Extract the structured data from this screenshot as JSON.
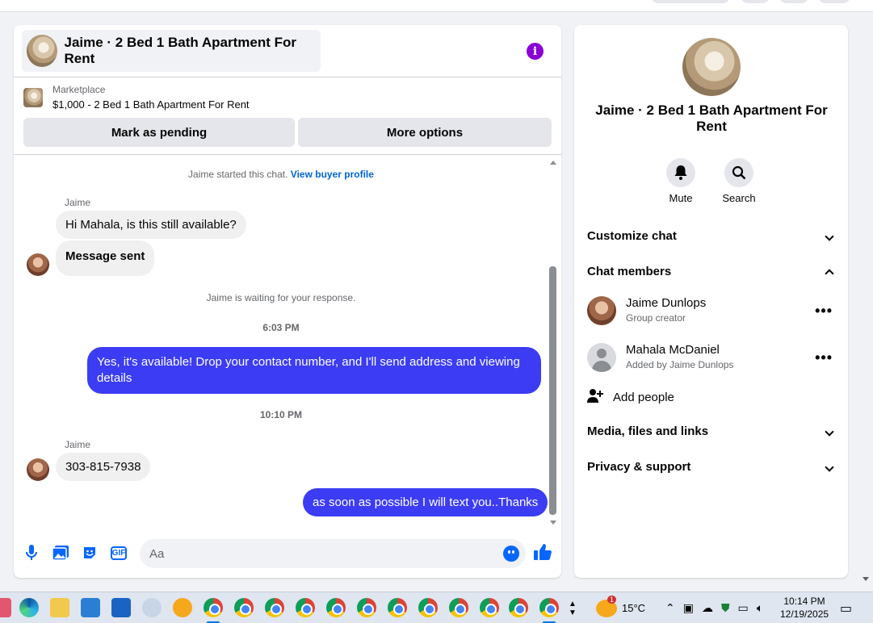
{
  "chat": {
    "header_title": "Jaime · 2 Bed 1 Bath Apartment For Rent",
    "listing_source": "Marketplace",
    "listing_price": "$1,000 - 2 Bed 1 Bath Apartment For Rent",
    "mark_pending_label": "Mark as pending",
    "more_options_label": "More options",
    "started_text": "Jaime started this chat.",
    "view_buyer_link": "View buyer profile",
    "messages": [
      {
        "sender": "Jaime",
        "text": "Hi Mahala, is this still available?",
        "direction": "in"
      },
      {
        "text": "Message sent",
        "direction": "in"
      },
      {
        "system": "Jaime is waiting for your response."
      },
      {
        "time": "6:03 PM"
      },
      {
        "text": "Yes, it's available! Drop your contact number, and I'll send address and viewing details",
        "direction": "out"
      },
      {
        "time": "10:10 PM"
      },
      {
        "sender": "Jaime",
        "text": "303-815-7938",
        "direction": "in"
      },
      {
        "text": "as soon as possible I will text you..Thanks",
        "direction": "out"
      }
    ],
    "composer_placeholder": "Aa"
  },
  "side": {
    "title": "Jaime · 2 Bed 1 Bath Apartment For Rent",
    "actions": [
      {
        "label": "Mute",
        "icon": "bell-icon"
      },
      {
        "label": "Search",
        "icon": "search-icon"
      }
    ],
    "customize_chat": "Customize chat",
    "chat_members": "Chat members",
    "members": [
      {
        "name": "Jaime Dunlops",
        "subtitle": "Group creator"
      },
      {
        "name": "Mahala McDaniel",
        "subtitle": "Added by Jaime Dunlops"
      }
    ],
    "add_people": "Add people",
    "media_files_links": "Media, files and links",
    "privacy_support": "Privacy & support"
  },
  "taskbar": {
    "temperature": "15°C",
    "time": "10:14 PM",
    "date": "12/19/2025",
    "weather_badge": "1"
  },
  "colors": {
    "outgoing_bubble": "#3c3cf5",
    "accent_blue": "#0866ff",
    "info_purple": "#8a00d4"
  }
}
